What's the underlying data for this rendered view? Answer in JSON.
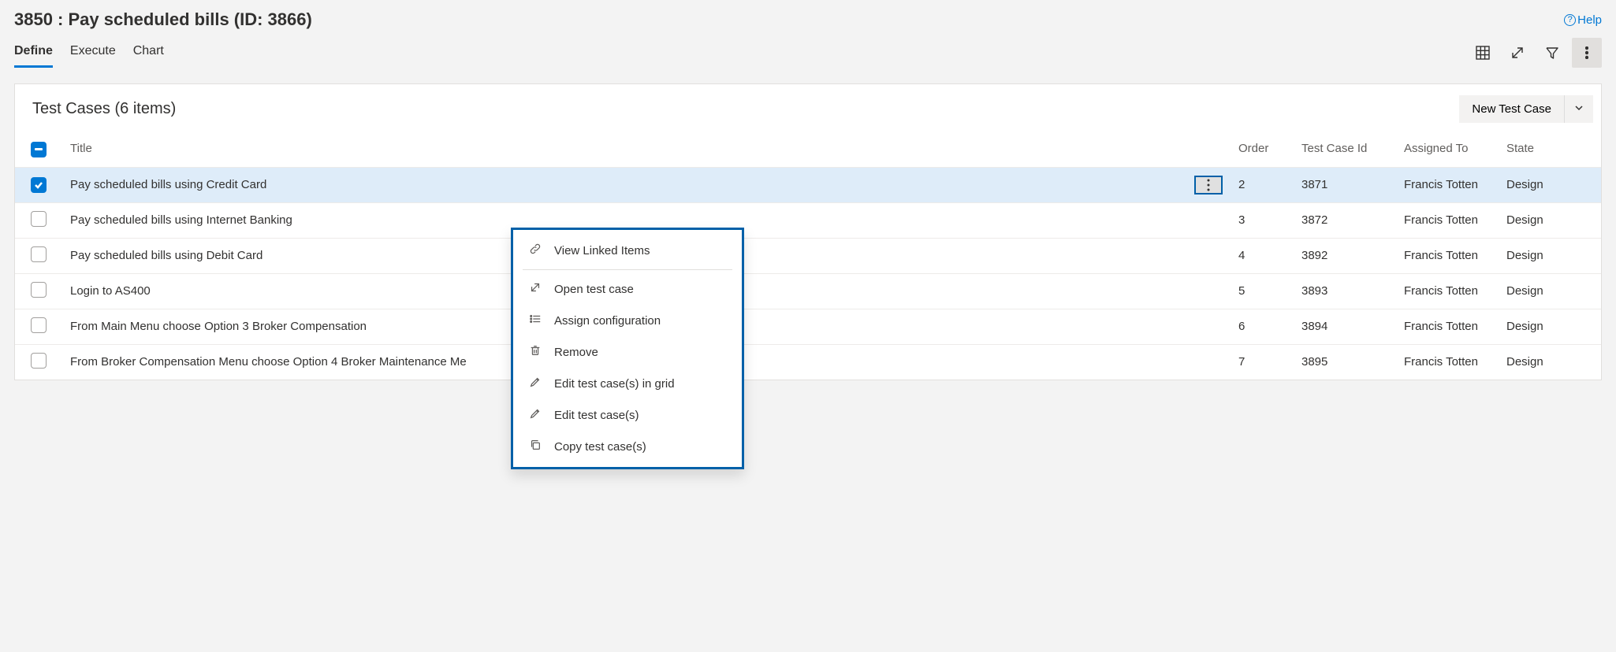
{
  "header": {
    "title": "3850 : Pay scheduled bills (ID: 3866)",
    "help_label": "Help"
  },
  "tabs": [
    {
      "label": "Define",
      "active": true
    },
    {
      "label": "Execute",
      "active": false
    },
    {
      "label": "Chart",
      "active": false
    }
  ],
  "card": {
    "title": "Test Cases (6 items)",
    "new_button": "New Test Case"
  },
  "columns": {
    "title": "Title",
    "order": "Order",
    "test_case_id": "Test Case Id",
    "assigned_to": "Assigned To",
    "state": "State"
  },
  "rows": [
    {
      "selected": true,
      "title": "Pay scheduled bills using Credit Card",
      "order": "2",
      "id": "3871",
      "assigned": "Francis Totten",
      "state": "Design"
    },
    {
      "selected": false,
      "title": "Pay scheduled bills using Internet Banking",
      "order": "3",
      "id": "3872",
      "assigned": "Francis Totten",
      "state": "Design"
    },
    {
      "selected": false,
      "title": "Pay scheduled bills using Debit Card",
      "order": "4",
      "id": "3892",
      "assigned": "Francis Totten",
      "state": "Design"
    },
    {
      "selected": false,
      "title": "Login to AS400",
      "order": "5",
      "id": "3893",
      "assigned": "Francis Totten",
      "state": "Design"
    },
    {
      "selected": false,
      "title": "From Main Menu choose Option 3 Broker Compensation",
      "order": "6",
      "id": "3894",
      "assigned": "Francis Totten",
      "state": "Design"
    },
    {
      "selected": false,
      "title": "From Broker Compensation Menu choose Option 4 Broker Maintenance Me",
      "order": "7",
      "id": "3895",
      "assigned": "Francis Totten",
      "state": "Design"
    }
  ],
  "context_menu": [
    {
      "icon": "link",
      "label": "View Linked Items",
      "sep_after": true
    },
    {
      "icon": "open",
      "label": "Open test case"
    },
    {
      "icon": "list",
      "label": "Assign configuration"
    },
    {
      "icon": "trash",
      "label": "Remove"
    },
    {
      "icon": "pencil",
      "label": "Edit test case(s) in grid"
    },
    {
      "icon": "pencil",
      "label": "Edit test case(s)"
    },
    {
      "icon": "copy",
      "label": "Copy test case(s)"
    }
  ]
}
